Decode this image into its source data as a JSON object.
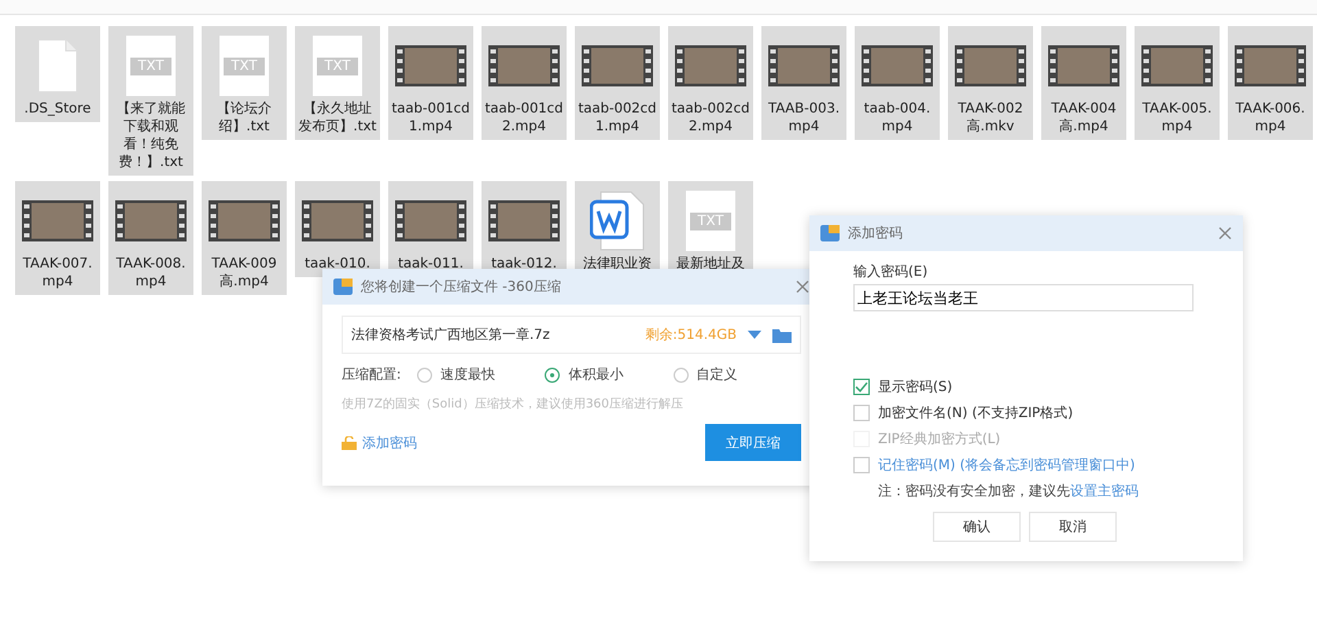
{
  "files": [
    {
      "kind": "blank",
      "name": ".DS_Store"
    },
    {
      "kind": "txt",
      "icon_label": "TXT",
      "name": "【来了就能下载和观看！纯免费！】.txt"
    },
    {
      "kind": "txt",
      "icon_label": "TXT",
      "name": "【论坛介绍】.txt"
    },
    {
      "kind": "txt",
      "icon_label": "TXT",
      "name": "【永久地址发布页】.txt"
    },
    {
      "kind": "video",
      "name": "taab-001cd1.mp4"
    },
    {
      "kind": "video",
      "name": "taab-001cd2.mp4"
    },
    {
      "kind": "video",
      "name": "taab-002cd1.mp4"
    },
    {
      "kind": "video",
      "name": "taab-002cd2.mp4"
    },
    {
      "kind": "video",
      "name": "TAAB-003.mp4"
    },
    {
      "kind": "video",
      "name": "taab-004.mp4"
    },
    {
      "kind": "video",
      "name": "TAAK-002高.mkv"
    },
    {
      "kind": "video",
      "name": "TAAK-004高.mp4"
    },
    {
      "kind": "video",
      "name": "TAAK-005.mp4"
    },
    {
      "kind": "video",
      "name": "TAAK-006.mp4"
    },
    {
      "kind": "video",
      "name": "TAAK-007.mp4"
    },
    {
      "kind": "video",
      "name": "TAAK-008.mp4"
    },
    {
      "kind": "video",
      "name": "TAAK-009高.mp4"
    },
    {
      "kind": "video",
      "name": "taak-010."
    },
    {
      "kind": "video",
      "name": "taak-011."
    },
    {
      "kind": "video",
      "name": "taak-012."
    },
    {
      "kind": "word",
      "name": "法律职业资"
    },
    {
      "kind": "txt",
      "icon_label": "TXT",
      "name": "最新地址及"
    }
  ],
  "compress_dialog": {
    "title": "您将创建一个压缩文件 -360压缩",
    "filename": "法律资格考试广西地区第一章.7z",
    "free_space": "剩余:514.4GB",
    "config_label": "压缩配置:",
    "options": [
      {
        "label": "速度最快",
        "selected": false
      },
      {
        "label": "体积最小",
        "selected": true
      },
      {
        "label": "自定义",
        "selected": false
      }
    ],
    "hint": "使用7Z的固实（Solid）压缩技术，建议使用360压缩进行解压",
    "add_password": "添加密码",
    "submit": "立即压缩"
  },
  "password_dialog": {
    "title": "添加密码",
    "input_label": "输入密码(E)",
    "password": "上老王论坛当老王",
    "options": [
      {
        "label": "显示密码(S)",
        "checked": true,
        "disabled": false,
        "link": false
      },
      {
        "label": "加密文件名(N) (不支持ZIP格式)",
        "checked": false,
        "disabled": false,
        "link": false
      },
      {
        "label": "ZIP经典加密方式(L)",
        "checked": false,
        "disabled": true,
        "link": false
      },
      {
        "label": "记住密码(M) (将会备忘到密码管理窗口中)",
        "checked": false,
        "disabled": false,
        "link": true
      }
    ],
    "note": "注：密码没有安全加密，建议先",
    "note_link": "设置主密码",
    "buttons": [
      "确认",
      "取消"
    ]
  }
}
